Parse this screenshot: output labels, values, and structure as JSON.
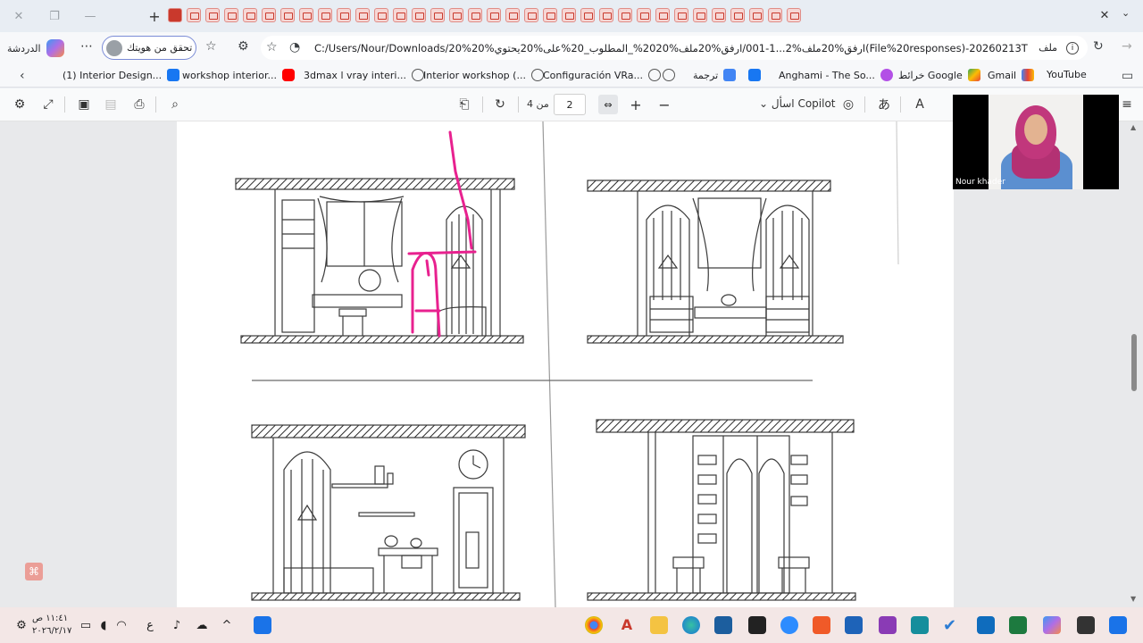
{
  "browser": {
    "tab_close_glyph": "✕",
    "chat_label": "الدردشة",
    "verify_label": "تحقق من هويتك",
    "address_url": "C:/Users/Nour/Downloads/20%ارفق%20ملف%2...1-001/ارفق%20ملف%2020%_المطلوب_20%على%20يحتوي%20(File%20responses)-20260213T110003Z-1-001/ارفق%20ملف%20pdf%2020%_المطلوب_20%على%20يحتوي",
    "address_prefix": "ملف"
  },
  "bookmarks": [
    {
      "label": "(1) Interior Design...",
      "icon": "facebook-icon"
    },
    {
      "label": "workshop interior...",
      "icon": "youtube-icon"
    },
    {
      "label": "3dmax l vray interi...",
      "icon": "globe-icon"
    },
    {
      "label": "Interior workshop (...",
      "icon": "globe-icon"
    },
    {
      "label": "Configuración VRa...",
      "icon": "globe-icon"
    },
    {
      "label": "ترجمة",
      "icon": "translate-icon"
    },
    {
      "label": "Anghami - The So...",
      "icon": "anghami-icon"
    },
    {
      "label": "خرائط Google",
      "icon": "maps-icon"
    },
    {
      "label": "Gmail",
      "icon": "gmail-icon"
    },
    {
      "label": "YouTube",
      "icon": "youtube-icon"
    }
  ],
  "pdf_toolbar": {
    "current_page": "2",
    "page_of": "من 4",
    "ask_copilot": "اسأل Copilot"
  },
  "video": {
    "participant_name": "Nour khader"
  },
  "taskbar": {
    "time": "١١:٤١ ص",
    "date": "٢٠٢٦/٢/١٧",
    "lang": "ع"
  },
  "colors": {
    "annotation_pink": "#e8218f",
    "tab_pdf_red": "#c9392c",
    "taskbar_bg": "#f3e7e6"
  }
}
